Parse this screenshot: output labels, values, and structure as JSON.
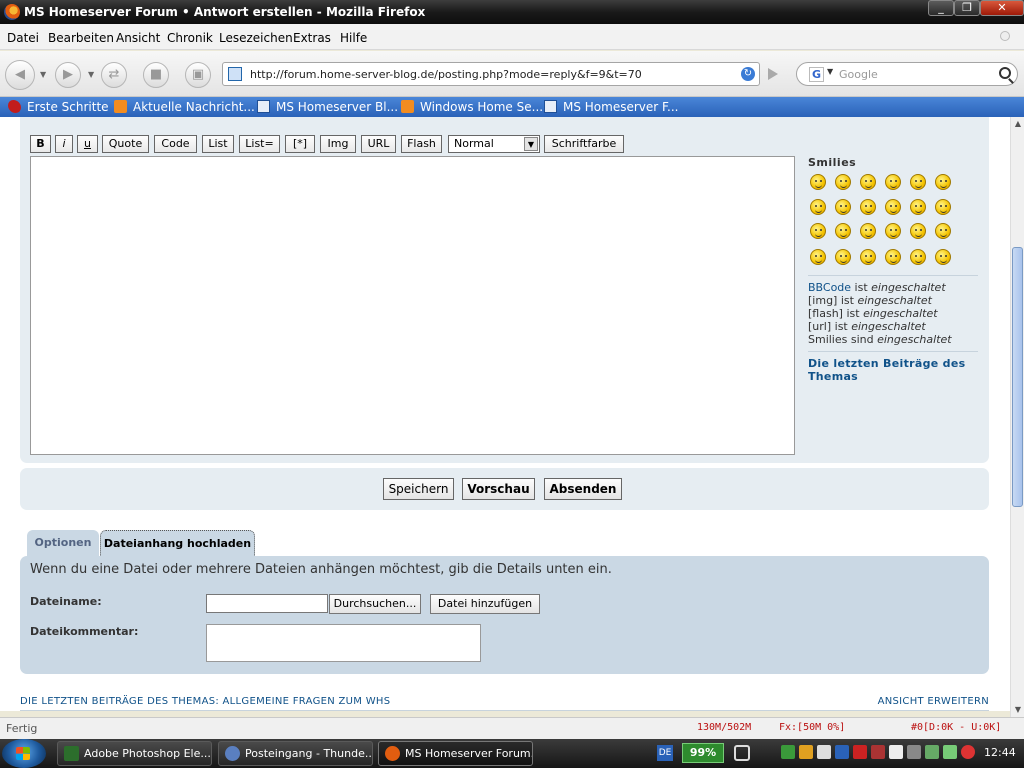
{
  "window": {
    "title": "MS Homeserver Forum • Antwort erstellen - Mozilla Firefox",
    "minimize": "_",
    "maximize": "❐",
    "close": "✕"
  },
  "menu": [
    "Datei",
    "Bearbeiten",
    "Ansicht",
    "Chronik",
    "Lesezeichen",
    "Extras",
    "Hilfe"
  ],
  "nav": {
    "url": "http://forum.home-server-blog.de/posting.php?mode=reply&f=9&t=70",
    "search_placeholder": "Google",
    "search_engine_letter": "G"
  },
  "bookmarks": [
    {
      "label": "Erste Schritte",
      "icon": "dragon-icon"
    },
    {
      "label": "Aktuelle Nachricht...",
      "icon": "rss-icon"
    },
    {
      "label": "MS Homeserver Bl...",
      "icon": "house-icon"
    },
    {
      "label": "Windows Home Se...",
      "icon": "rss-icon"
    },
    {
      "label": "MS Homeserver F...",
      "icon": "house-icon"
    }
  ],
  "editor": {
    "toolbar": [
      "B",
      "i",
      "u",
      "Quote",
      "Code",
      "List",
      "List=",
      "[*]",
      "Img",
      "URL",
      "Flash"
    ],
    "font_size": "Normal",
    "font_color": "Schriftfarbe"
  },
  "sidebar": {
    "smilies_title": "Smilies",
    "status": [
      {
        "key": "BBCode",
        "text": " ist ",
        "state": "eingeschaltet"
      },
      {
        "key": "[img]",
        "text": " ist ",
        "state": "eingeschaltet"
      },
      {
        "key": "[flash]",
        "text": " ist ",
        "state": "eingeschaltet"
      },
      {
        "key": "[url]",
        "text": " ist ",
        "state": "eingeschaltet"
      },
      {
        "key": "Smilies",
        "text": " sind ",
        "state": "eingeschaltet"
      }
    ],
    "last_posts": "Die letzten Beiträge des Themas"
  },
  "submit": {
    "save": "Speichern",
    "preview": "Vorschau",
    "send": "Absenden"
  },
  "tabs": {
    "options": "Optionen",
    "attachment": "Dateianhang hochladen"
  },
  "attachment": {
    "intro": "Wenn du eine Datei oder mehrere Dateien anhängen möchtest, gib die Details unten ein.",
    "filename_label": "Dateiname:",
    "browse": "Durchsuchen...",
    "add_file": "Datei hinzufügen",
    "comment_label": "Dateikommentar:"
  },
  "bottom": {
    "topic_review": "DIE LETZTEN BEITRÄGE DES THEMAS: ALLGEMEINE FRAGEN ZUM WHS",
    "expand": "ANSICHT ERWEITERN"
  },
  "statusbar": {
    "done": "Fertig",
    "memory": "130M/502M",
    "fx": "Fx:[50M  0%]",
    "download": "#0[D:0K - U:0K]"
  },
  "taskbar": {
    "tasks": [
      {
        "label": "Adobe Photoshop Ele...",
        "icon": "photoshop-icon"
      },
      {
        "label": "Posteingang - Thunde...",
        "icon": "thunderbird-icon"
      },
      {
        "label": "MS Homeserver Forum...",
        "icon": "firefox-icon"
      }
    ],
    "lang": "DE",
    "battery": "99%",
    "clock": "12:44"
  },
  "colors": {
    "link": "#105289",
    "panel": "#e6edf2",
    "panel_attach": "#cad8e4",
    "bookmark_bar": "#2a62b8"
  }
}
